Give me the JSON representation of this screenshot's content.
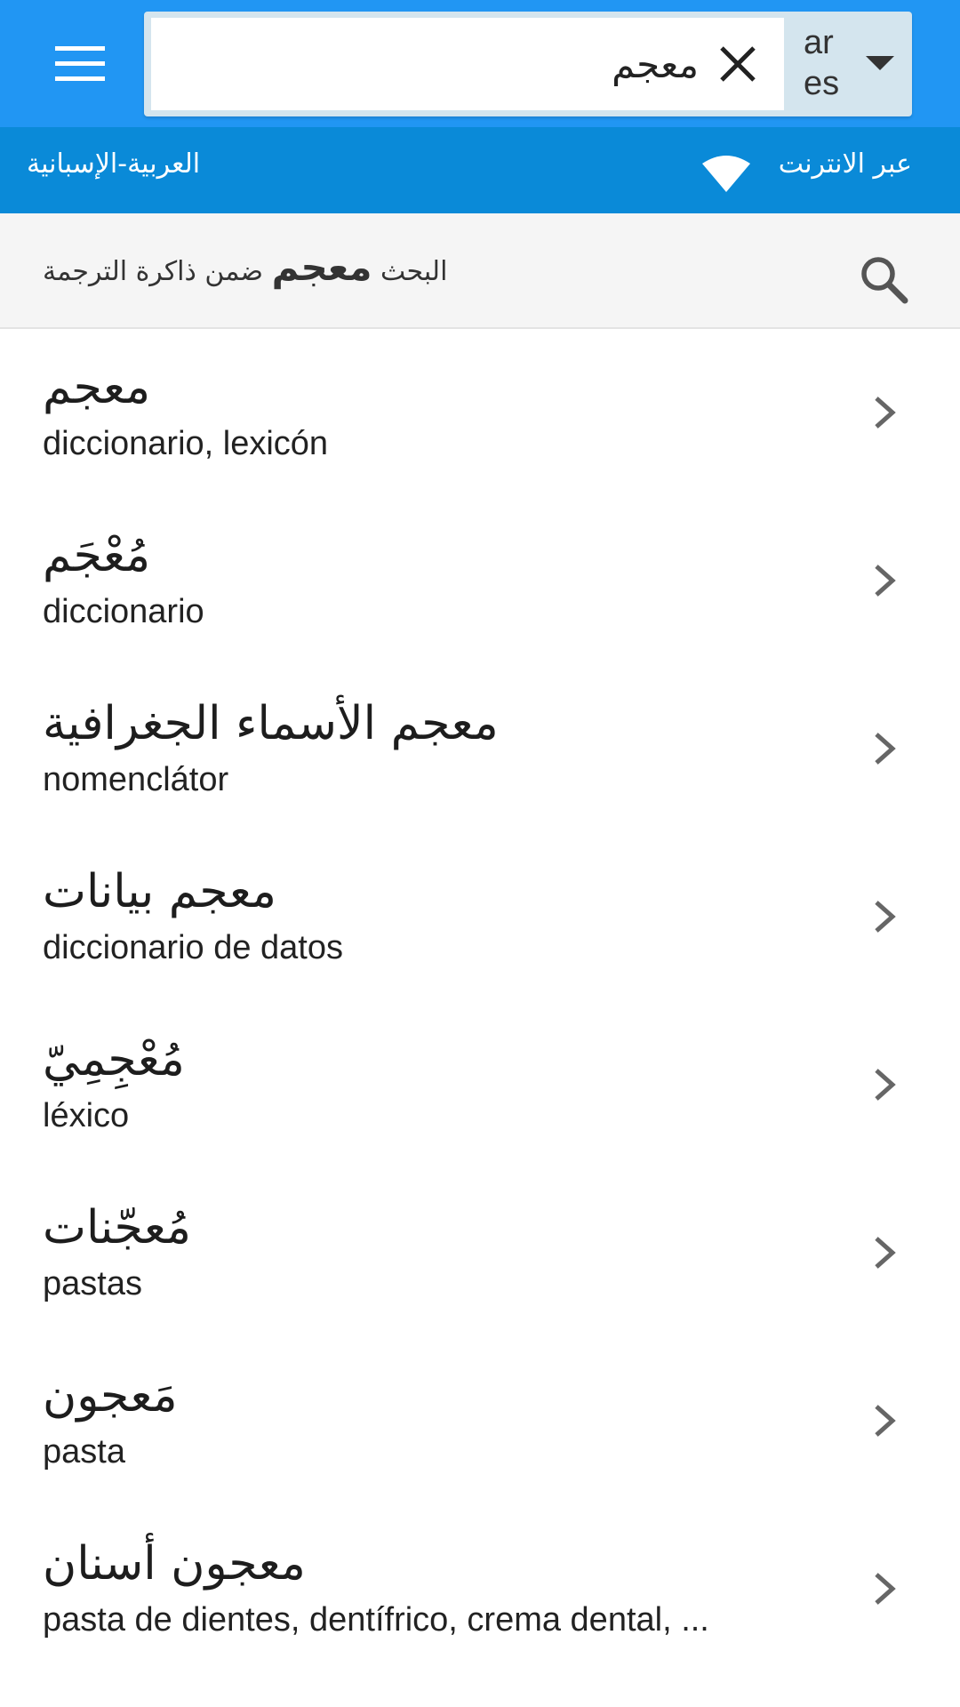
{
  "search": {
    "value": "معجم",
    "source_lang": "ar",
    "target_lang": "es"
  },
  "statusbar": {
    "dictionary": "العربية-الإسبانية",
    "connection": "عبر الانترنت"
  },
  "translation_memory": {
    "prefix": "البحث",
    "term": "معجم",
    "suffix": "ضمن ذاكرة الترجمة"
  },
  "results": [
    {
      "arabic": "معجم",
      "spanish": "diccionario, lexicón"
    },
    {
      "arabic": "مُعْجَم",
      "spanish": "diccionario"
    },
    {
      "arabic": "معجم الأسماء الجغرافية",
      "spanish": "nomenclátor"
    },
    {
      "arabic": "معجم بيانات",
      "spanish": "diccionario de datos"
    },
    {
      "arabic": "مُعْجِمِيّ",
      "spanish": "léxico"
    },
    {
      "arabic": "مُعجّنات",
      "spanish": "pastas"
    },
    {
      "arabic": "مَعجون",
      "spanish": "pasta"
    },
    {
      "arabic": "معجون أسنان",
      "spanish": "pasta de dientes, dentífrico, crema dental, ..."
    }
  ],
  "icons": {
    "menu": "menu-icon",
    "clear": "close-icon",
    "dropdown": "caret-down-icon",
    "wifi": "wifi-icon",
    "search": "search-icon",
    "chevron": "chevron-right-icon"
  },
  "colors": {
    "appbar": "#2196f3",
    "statusbar": "#0a8ad8",
    "lang_box": "#d4e5ee",
    "tm_background": "#f5f5f5"
  }
}
